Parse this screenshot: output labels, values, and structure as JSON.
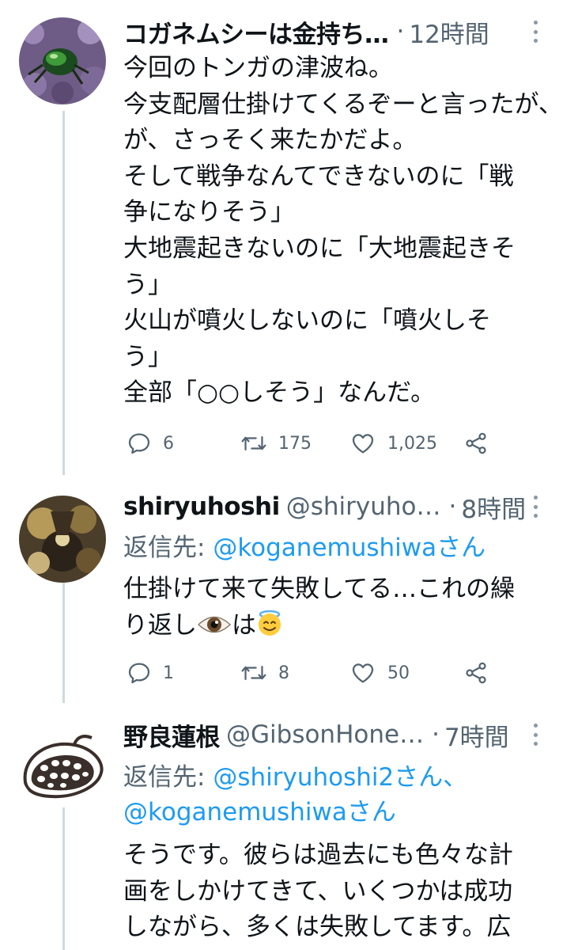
{
  "tweets": [
    {
      "name": "コガネムシーは金持ち…",
      "handle": "",
      "time": "12時間",
      "lines": [
        "今回のトンガの津波ね。",
        "今支配層仕掛けてくるぞーと言ったが、",
        "が、さっそく来たかだよ。",
        "そして戦争なんてできないのに「戦",
        "争になりそう」",
        "大地震起きないのに「大地震起きそ",
        "う」",
        "火山が噴火しないのに「噴火しそ",
        "う」",
        "全部「○○しそう」なんだ。"
      ],
      "replies": "6",
      "retweets": "175",
      "likes": "1,025"
    },
    {
      "name": "shiryuhoshi",
      "handle": "@shiryuho…",
      "time": "8時間",
      "reply_prefix": "返信先: ",
      "reply_to": "@koganemushiwaさん",
      "lines": [
        "仕掛けて来て失敗してる…これの繰",
        "り返し"
      ],
      "line2_tail": "は",
      "replies": "1",
      "retweets": "8",
      "likes": "50"
    },
    {
      "name": "野良蓮根",
      "handle": "@GibsonHone…",
      "time": "7時間",
      "reply_prefix": "返信先: ",
      "reply_to_1": "@shiryuhoshi2さん、",
      "reply_to_2": "@koganemushiwaさん",
      "lines": [
        "そうです。彼らは過去にも色々な計",
        "画をしかけてきて、いくつかは成功",
        "しながら、多くは失敗してます。広"
      ]
    }
  ],
  "colors": {
    "muted": "#536471",
    "link": "#1d9bf0",
    "thread": "#cfd9de"
  },
  "icons": [
    "more-icon",
    "reply-icon",
    "retweet-icon",
    "like-icon",
    "share-icon",
    "eye-emoji",
    "halo-smile-emoji"
  ]
}
